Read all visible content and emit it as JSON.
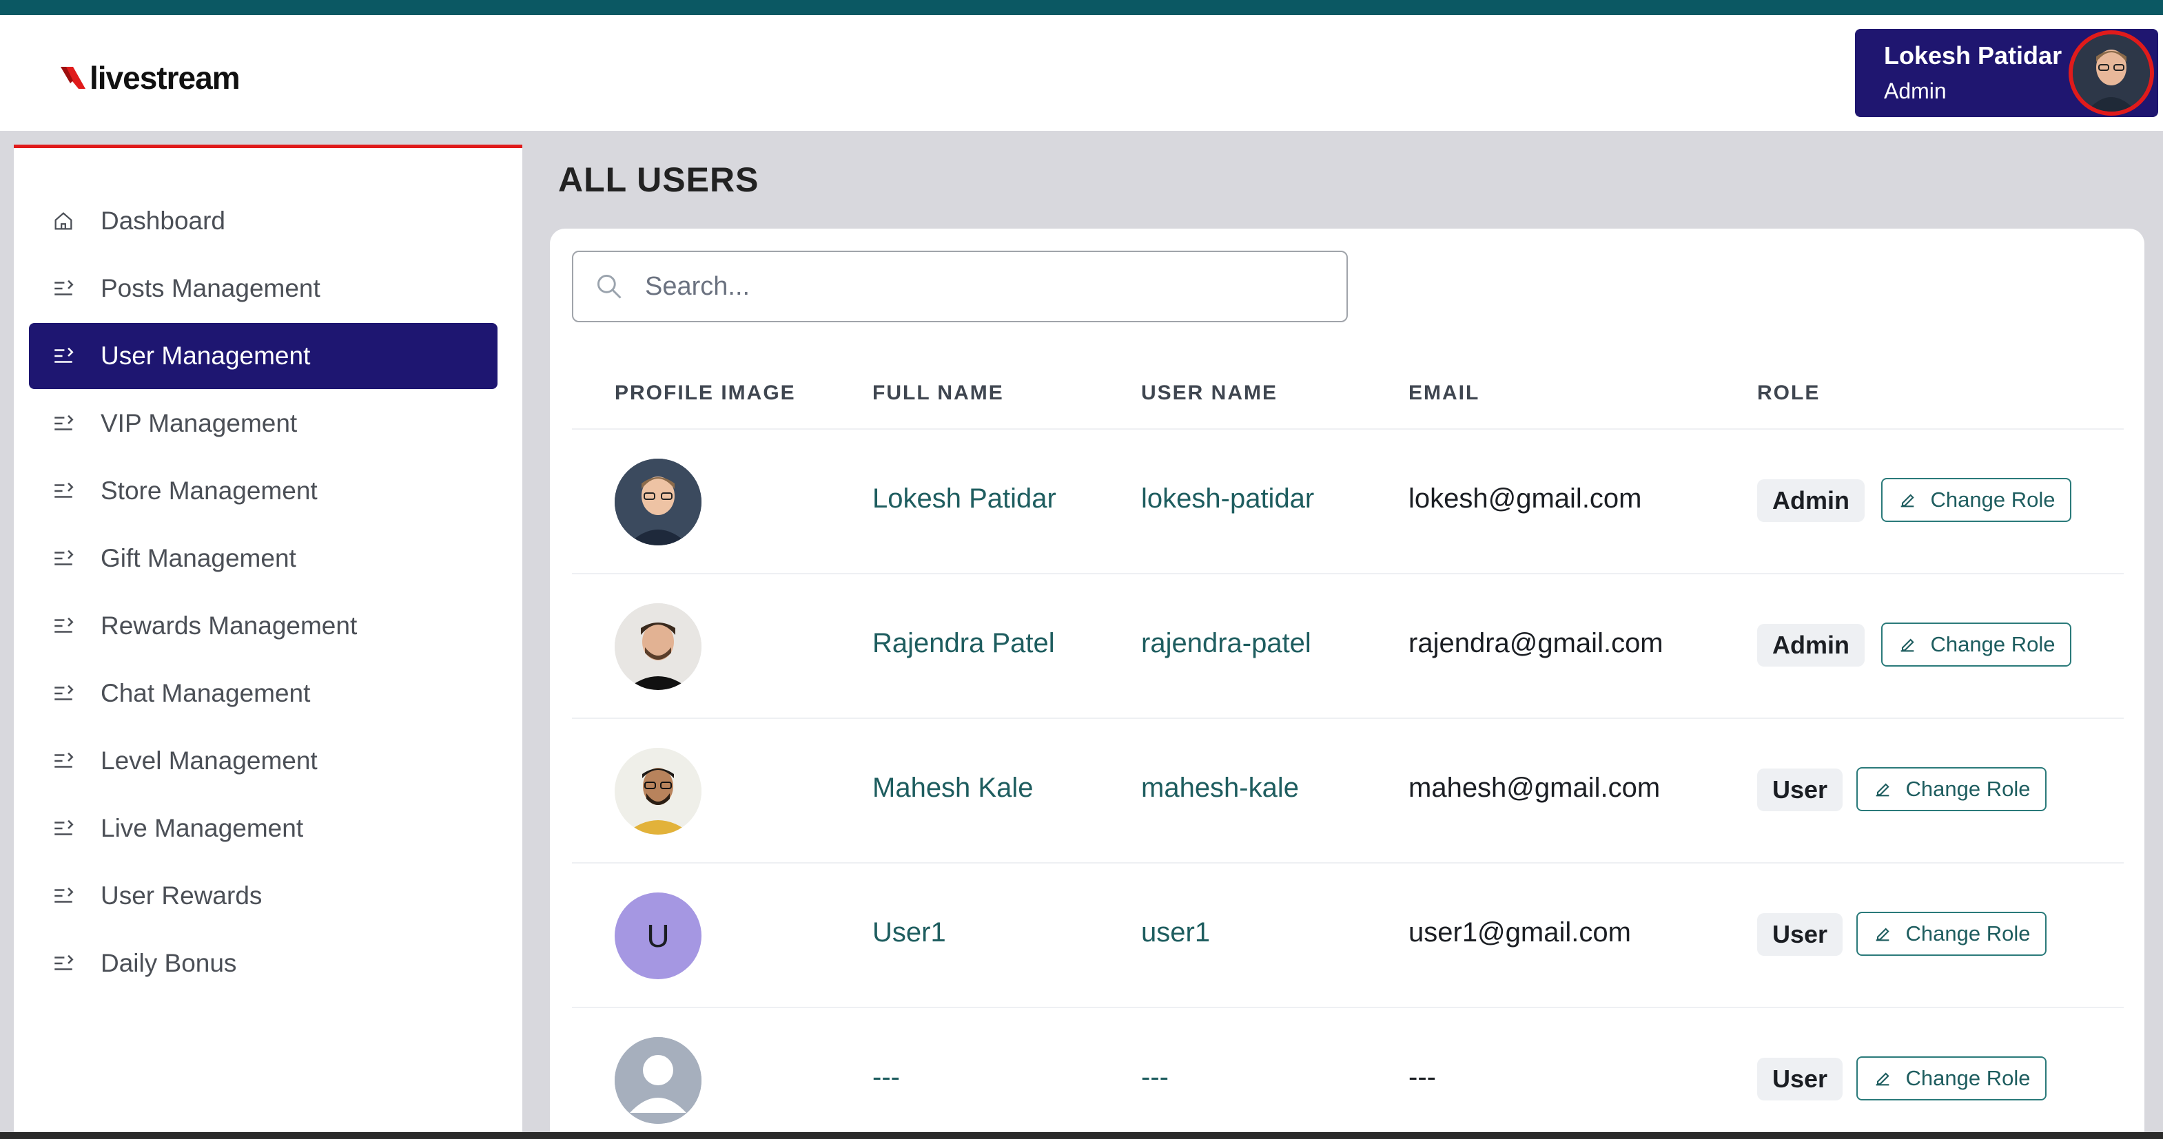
{
  "app": {
    "logo_text": "livestream",
    "brand_color": "#e01b1b",
    "accent": "#1e1671"
  },
  "header": {
    "user_name": "Lokesh Patidar",
    "user_role": "Admin"
  },
  "sidebar": {
    "items": [
      {
        "label": "Dashboard",
        "icon": "home-icon",
        "active": false
      },
      {
        "label": "Posts Management",
        "icon": "list-arrow-icon",
        "active": false
      },
      {
        "label": "User Management",
        "icon": "list-arrow-icon",
        "active": true
      },
      {
        "label": "VIP Management",
        "icon": "list-arrow-icon",
        "active": false
      },
      {
        "label": "Store Management",
        "icon": "list-arrow-icon",
        "active": false
      },
      {
        "label": "Gift Management",
        "icon": "list-arrow-icon",
        "active": false
      },
      {
        "label": "Rewards Management",
        "icon": "list-arrow-icon",
        "active": false
      },
      {
        "label": "Chat Management",
        "icon": "list-arrow-icon",
        "active": false
      },
      {
        "label": "Level Management",
        "icon": "list-arrow-icon",
        "active": false
      },
      {
        "label": "Live Management",
        "icon": "list-arrow-icon",
        "active": false
      },
      {
        "label": "User Rewards",
        "icon": "list-arrow-icon",
        "active": false
      },
      {
        "label": "Daily Bonus",
        "icon": "list-arrow-icon",
        "active": false
      }
    ]
  },
  "main": {
    "title": "ALL USERS",
    "search_placeholder": "Search...",
    "columns": [
      "PROFILE IMAGE",
      "FULL NAME",
      "USER NAME",
      "EMAIL",
      "ROLE"
    ],
    "change_role_label": "Change Role",
    "rows": [
      {
        "avatar": "photo",
        "initial": "",
        "full_name": "Lokesh Patidar",
        "user_name": "lokesh-patidar",
        "email": "lokesh@gmail.com",
        "role": "Admin"
      },
      {
        "avatar": "photo",
        "initial": "",
        "full_name": "Rajendra Patel",
        "user_name": "rajendra-patel",
        "email": "rajendra@gmail.com",
        "role": "Admin"
      },
      {
        "avatar": "photo",
        "initial": "",
        "full_name": "Mahesh Kale",
        "user_name": "mahesh-kale",
        "email": "mahesh@gmail.com",
        "role": "User"
      },
      {
        "avatar": "initial",
        "initial": "U",
        "full_name": "User1",
        "user_name": "user1",
        "email": "user1@gmail.com",
        "role": "User"
      },
      {
        "avatar": "placeholder",
        "initial": "",
        "full_name": "---",
        "user_name": "---",
        "email": "---",
        "role": "User"
      }
    ]
  }
}
